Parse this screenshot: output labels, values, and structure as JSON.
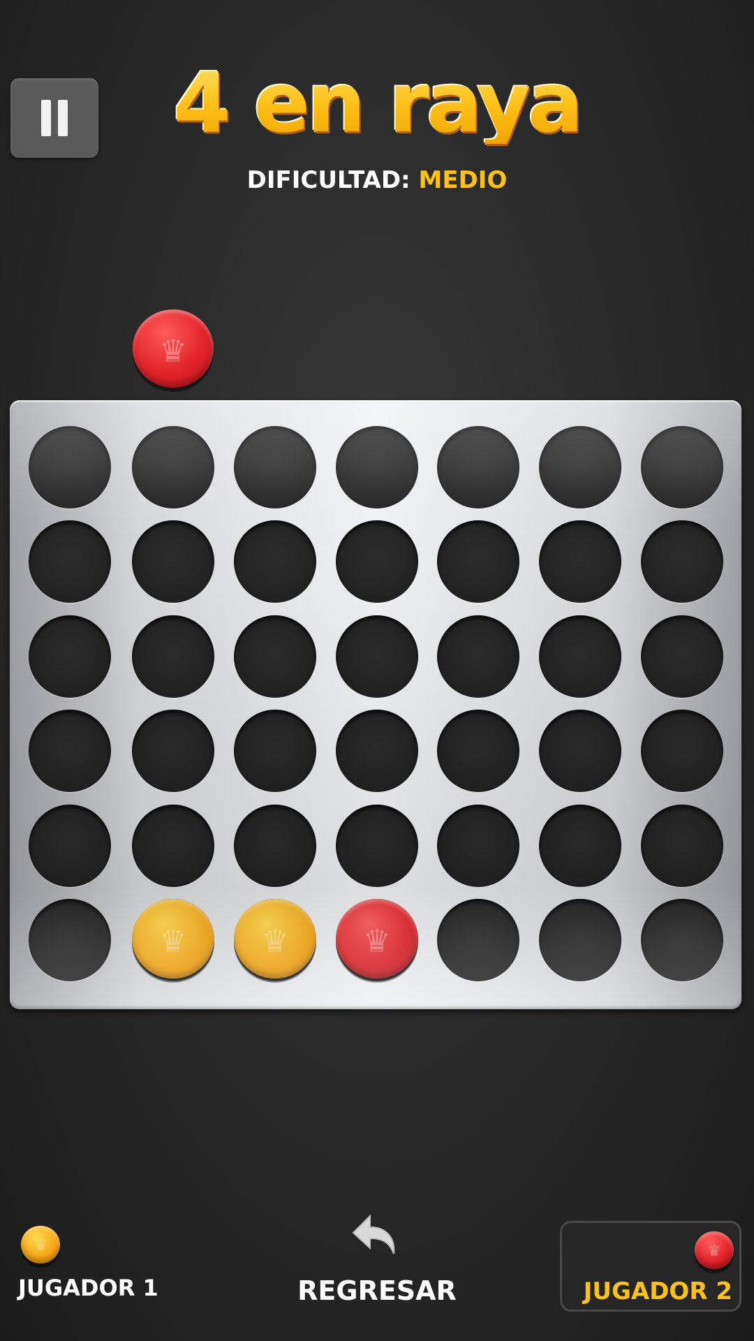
{
  "header": {
    "title": "4 en raya",
    "difficulty_label": "DIFICULTAD:",
    "difficulty_value": "MEDIO"
  },
  "board": {
    "columns": 7,
    "rows": 6,
    "cells": [
      [
        "",
        "",
        "",
        "",
        "",
        "",
        ""
      ],
      [
        "",
        "",
        "",
        "",
        "",
        "",
        ""
      ],
      [
        "",
        "",
        "",
        "",
        "",
        "",
        ""
      ],
      [
        "",
        "",
        "",
        "",
        "",
        "",
        ""
      ],
      [
        "",
        "",
        "",
        "",
        "",
        "",
        ""
      ],
      [
        "",
        "yellow",
        "yellow",
        "red",
        "",
        "",
        ""
      ]
    ],
    "pending_disc": {
      "color": "red",
      "column": 2
    }
  },
  "footer": {
    "player1": {
      "label": "JUGADOR 1",
      "color": "yellow"
    },
    "back": {
      "label": "REGRESAR"
    },
    "player2": {
      "label": "JUGADOR 2",
      "color": "red",
      "active": true
    }
  },
  "colors": {
    "accent": "#ffc21a",
    "red_disc": "#e0242a",
    "yellow_disc": "#f6a513"
  },
  "icons": {
    "pause": "pause-icon",
    "crown": "crown-icon",
    "back": "undo-arrow-icon"
  }
}
